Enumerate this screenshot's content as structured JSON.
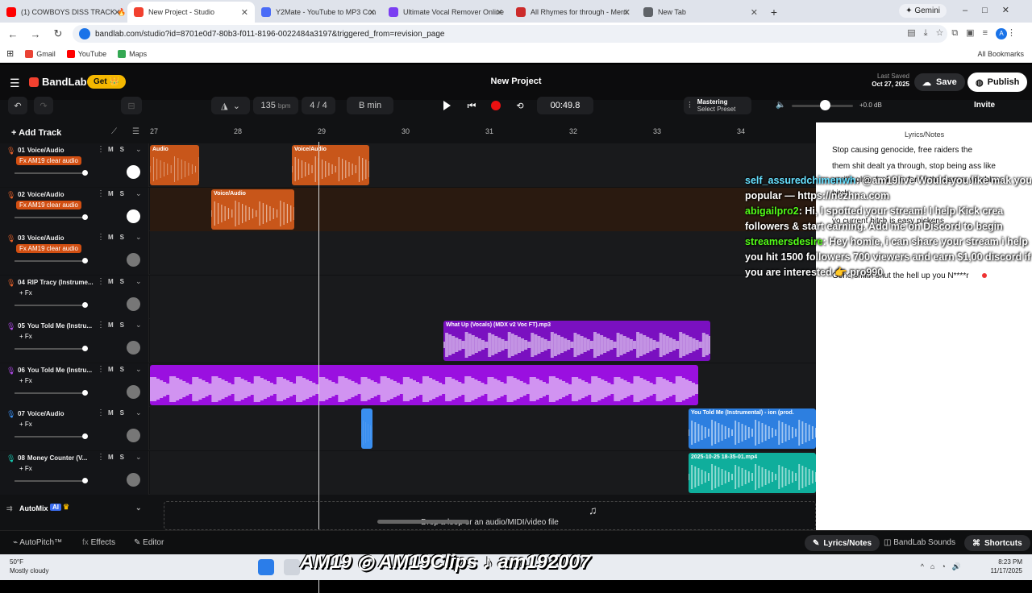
{
  "browser": {
    "tabs": [
      {
        "label": "(1) COWBOYS DISS TRACK 🔥 I",
        "color": "#ff0000"
      },
      {
        "label": "New Project - Studio",
        "color": "#f2412f",
        "active": true
      },
      {
        "label": "Y2Mate - YouTube to MP3 Con",
        "color": "#4a6cf7"
      },
      {
        "label": "Ultimate Vocal Remover Online",
        "color": "#7b3ff2"
      },
      {
        "label": "All Rhymes for through - Merri",
        "color": "#cc2b2b"
      },
      {
        "label": "New Tab",
        "color": "#5f6368"
      }
    ],
    "gemini": "✦ Gemini",
    "url": "bandlab.com/studio?id=8701e0d7-80b3-f011-8196-0022484a3197&triggered_from=revision_page",
    "profile_initial": "A",
    "bookmarks": [
      {
        "label": "Gmail",
        "color": "#ea4335"
      },
      {
        "label": "YouTube",
        "color": "#ff0000"
      },
      {
        "label": "Maps",
        "color": "#34a853"
      }
    ],
    "all_bookmarks": "All Bookmarks"
  },
  "app": {
    "brand": "BandLab",
    "get_label": "Get 👑",
    "project_title": "New Project",
    "last_saved_label": "Last Saved",
    "last_saved_date": "Oct 27, 2025",
    "save_label": "Save",
    "publish_label": "Publish",
    "tempo": "135",
    "tempo_unit": "bpm",
    "time_signature": "4 / 4",
    "key": "B min",
    "time": "00:49.8",
    "mastering_label": "Mastering",
    "mastering_preset": "Select Preset",
    "volume_db": "+0.0 dB",
    "invite_label": "Invite",
    "add_track_label": "Add Track",
    "ruler_marks": [
      "27",
      "28",
      "29",
      "30",
      "31",
      "32",
      "33",
      "34"
    ],
    "automix_label": "AutoMix",
    "automix_badge": "AI",
    "drop_zone_text": "Drop a loop or an audio/MIDI/video file",
    "bottom": {
      "autopitch": "AutoPitch™",
      "effects": "Effects",
      "editor": "Editor",
      "lyrics_notes": "Lyrics/Notes",
      "sounds": "BandLab Sounds",
      "shortcuts": "Shortcuts"
    }
  },
  "tracks": [
    {
      "num": "01",
      "name": "Voice/Audio",
      "fx": "Fx AM19 clear audio",
      "fx_on": true,
      "icon_color": "#e8622a",
      "clips": [
        {
          "label": "Audio",
          "color": "#c8561a"
        },
        {
          "label": "Voice/Audio",
          "color": "#c8561a"
        }
      ]
    },
    {
      "num": "02",
      "name": "Voice/Audio",
      "fx": "Fx AM19 clear audio",
      "fx_on": true,
      "icon_color": "#e8622a",
      "clips": [
        {
          "label": "Voice/Audio",
          "color": "#c8561a"
        }
      ]
    },
    {
      "num": "03",
      "name": "Voice/Audio",
      "fx": "Fx AM19 clear audio",
      "fx_on": true,
      "icon_color": "#e8622a",
      "clips": []
    },
    {
      "num": "04",
      "name": "RIP Tracy (Instrume...",
      "fx": "+ Fx",
      "fx_on": false,
      "icon_color": "#e8622a",
      "clips": []
    },
    {
      "num": "05",
      "name": "You Told Me (Instru...",
      "fx": "+ Fx",
      "fx_on": false,
      "icon_color": "#b04ae8",
      "clips": [
        {
          "label": "What Up (Vocals) (MDX v2 Voc FT).mp3",
          "color": "#7a10c0"
        }
      ]
    },
    {
      "num": "06",
      "name": "You Told Me (Instru...",
      "fx": "+ Fx",
      "fx_on": false,
      "icon_color": "#b04ae8",
      "clips": [
        {
          "label": "",
          "color": "#9a10e0"
        }
      ]
    },
    {
      "num": "07",
      "name": "Voice/Audio",
      "fx": "+ Fx",
      "fx_on": false,
      "icon_color": "#3a8ff0",
      "clips": [
        {
          "label": "",
          "color": "#3a8ff0"
        },
        {
          "label": "You Told Me (Instrumental) - ion (prod.",
          "color": "#2d7fe0"
        }
      ]
    },
    {
      "num": "08",
      "name": "Money Counter (V...",
      "fx": "+ Fx",
      "fx_on": false,
      "icon_color": "#18c9b0",
      "clips": [
        {
          "label": "2025-10-25 18-35-01.mp4",
          "color": "#0fae9c"
        }
      ]
    }
  ],
  "notes": {
    "title": "Lyrics/Notes",
    "lines": [
      "Stop causing genocide, free raiders the",
      "them shit dealt ya through, stop being ass like gorilla glue, fuck you for all the games you blew,   bitch",
      "yo current bitch is easy pickens",
      "Geno smith shut the hell up you N****r"
    ]
  },
  "chat": [
    {
      "user": "self_assuredchimenwh",
      "msg": "@am19live Would you like mak you popular — https://nezhna.com"
    },
    {
      "user": "abigailpro2",
      "msg": "Hi, I spotted your stream! I help Kick crea followers & start earning. Add me on Discord to begin"
    },
    {
      "user": "streamersdesire",
      "msg": "Hey homie, i can share your stream i help you hit 1500 followers 700 viewers and earn $1,00 discord if you are interested 👉 pro990"
    }
  ],
  "taskbar": {
    "temp": "50°F",
    "weather": "Mostly cloudy",
    "overlay_text": "AM19 ◎ AM19Clips ♪ am192007",
    "time": "8:23 PM",
    "date": "11/17/2025"
  }
}
